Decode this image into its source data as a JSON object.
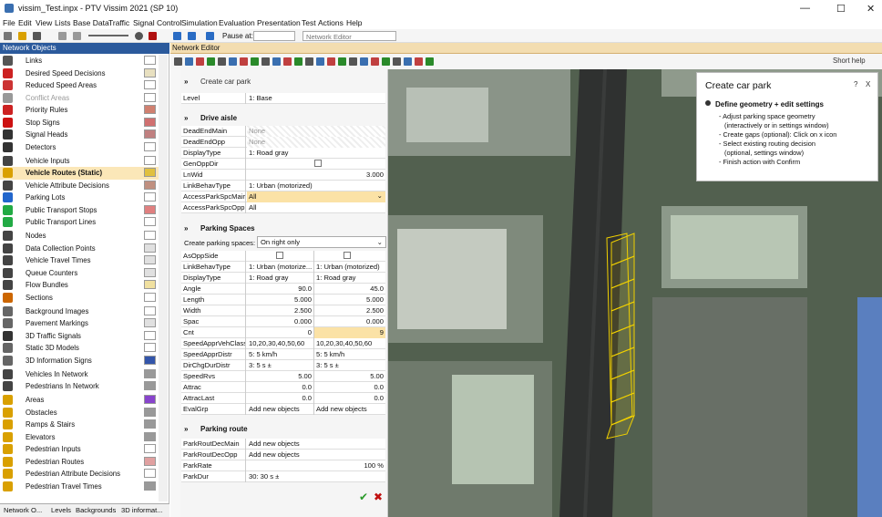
{
  "window": {
    "title": "vissim_Test.inpx - PTV Vissim 2021 (SP 10)",
    "controls": [
      "—",
      "☐",
      "✕"
    ]
  },
  "menu": [
    "File",
    "Edit",
    "View",
    "Lists",
    "Base Data",
    "Traffic",
    "Signal Control",
    "Simulation",
    "Evaluation",
    "Presentation",
    "Test",
    "Actions",
    "Help"
  ],
  "toolbar": {
    "pause_label": "Pause at:",
    "editor_select": "Network Editor"
  },
  "network_objects": {
    "title": "Network Objects",
    "items": [
      {
        "label": "Links",
        "icon_color": "#555555",
        "swatch": "#ffffff"
      },
      {
        "label": "Desired Speed Decisions",
        "icon_color": "#cc2222",
        "swatch": "#e8e0c0"
      },
      {
        "label": "Reduced Speed Areas",
        "icon_color": "#cc3333",
        "swatch": "#ffffff"
      },
      {
        "label": "Conflict Areas",
        "icon_color": "#999999",
        "swatch": "#ffffff",
        "dim": true
      },
      {
        "label": "Priority Rules",
        "icon_color": "#cc2222",
        "swatch": "#d08070"
      },
      {
        "label": "Stop Signs",
        "icon_color": "#cc1111",
        "swatch": "#d07070"
      },
      {
        "label": "Signal Heads",
        "icon_color": "#333333",
        "swatch": "#c08080"
      },
      {
        "label": "Detectors",
        "icon_color": "#333333",
        "swatch": "#ffffff"
      },
      {
        "label": "Vehicle Inputs",
        "icon_color": "#444444",
        "swatch": "#ffffff"
      },
      {
        "label": "Vehicle Routes (Static)",
        "icon_color": "#d9a000",
        "swatch": "#e0c040",
        "selected": true
      },
      {
        "label": "Vehicle Attribute Decisions",
        "icon_color": "#444444",
        "swatch": "#c09080"
      },
      {
        "label": "Parking Lots",
        "icon_color": "#2266cc",
        "swatch": "#ffffff"
      },
      {
        "label": "Public Transport Stops",
        "icon_color": "#22aa44",
        "swatch": "#e08080"
      },
      {
        "label": "Public Transport Lines",
        "icon_color": "#22aa44",
        "swatch": "#ffffff"
      },
      {
        "label": "Nodes",
        "icon_color": "#444444",
        "swatch": "#ffffff"
      },
      {
        "label": "Data Collection Points",
        "icon_color": "#444444",
        "swatch": "#e0e0e0"
      },
      {
        "label": "Vehicle Travel Times",
        "icon_color": "#444444",
        "swatch": "#e0e0e0"
      },
      {
        "label": "Queue Counters",
        "icon_color": "#444444",
        "swatch": "#e0e0e0"
      },
      {
        "label": "Flow Bundles",
        "icon_color": "#444444",
        "swatch": "#f0e0a0"
      },
      {
        "label": "Sections",
        "icon_color": "#cc6600",
        "swatch": "#ffffff"
      },
      {
        "label": "Background Images",
        "icon_color": "#666666",
        "swatch": "#ffffff"
      },
      {
        "label": "Pavement Markings",
        "icon_color": "#666666",
        "swatch": "#e0e0e0"
      },
      {
        "label": "3D Traffic Signals",
        "icon_color": "#333333",
        "swatch": "#ffffff"
      },
      {
        "label": "Static 3D Models",
        "icon_color": "#666666",
        "swatch": "#ffffff"
      },
      {
        "label": "3D Information Signs",
        "icon_color": "#666666",
        "swatch": "#3355aa"
      },
      {
        "label": "Vehicles In Network",
        "icon_color": "#444444",
        "swatch": "#999999"
      },
      {
        "label": "Pedestrians In Network",
        "icon_color": "#444444",
        "swatch": "#999999"
      },
      {
        "label": "Areas",
        "icon_color": "#d9a000",
        "swatch": "#8844cc"
      },
      {
        "label": "Obstacles",
        "icon_color": "#d9a000",
        "swatch": "#999999"
      },
      {
        "label": "Ramps & Stairs",
        "icon_color": "#d9a000",
        "swatch": "#999999"
      },
      {
        "label": "Elevators",
        "icon_color": "#d9a000",
        "swatch": "#999999"
      },
      {
        "label": "Pedestrian Inputs",
        "icon_color": "#d9a000",
        "swatch": "#ffffff"
      },
      {
        "label": "Pedestrian Routes",
        "icon_color": "#d9a000",
        "swatch": "#e0a0a0"
      },
      {
        "label": "Pedestrian Attribute Decisions",
        "icon_color": "#d9a000",
        "swatch": "#ffffff"
      },
      {
        "label": "Pedestrian Travel Times",
        "icon_color": "#d9a000",
        "swatch": "#999999"
      }
    ],
    "tabs": [
      "Network O...",
      "Levels",
      "Backgrounds",
      "3D informat..."
    ]
  },
  "editor": {
    "title": "Network Editor",
    "short_help": "Short help",
    "header_label": "Create car park",
    "level": {
      "key": "Level",
      "value": "1: Base"
    },
    "drive_aisle": {
      "title": "Drive aisle",
      "rows": [
        {
          "key": "DeadEndMain",
          "value": "None",
          "hatched": true
        },
        {
          "key": "DeadEndOpp",
          "value": "None",
          "hatched": true
        },
        {
          "key": "DisplayType",
          "value": "1: Road gray"
        },
        {
          "key": "GenOppDir",
          "value": ""
        },
        {
          "key": "LnWid",
          "value": "3.000"
        },
        {
          "key": "LinkBehavType",
          "value": "1: Urban (motorized)"
        },
        {
          "key": "AccessParkSpcMain",
          "value": "All"
        },
        {
          "key": "AccessParkSpcOpp",
          "value": "All"
        }
      ]
    },
    "parking_spaces": {
      "title": "Parking Spaces",
      "create_label": "Create parking spaces:",
      "create_value": "On right only",
      "rows": [
        {
          "key": "AsOppSide",
          "a": "",
          "b": ""
        },
        {
          "key": "LinkBehavType",
          "a": "1: Urban (motorize...",
          "b": "1: Urban (motorized)"
        },
        {
          "key": "DisplayType",
          "a": "1: Road gray",
          "b": "1: Road gray"
        },
        {
          "key": "Angle",
          "a": "90.0",
          "b": "45.0"
        },
        {
          "key": "Length",
          "a": "5.000",
          "b": "5.000"
        },
        {
          "key": "Width",
          "a": "2.500",
          "b": "2.500"
        },
        {
          "key": "Spac",
          "a": "0.000",
          "b": "0.000"
        },
        {
          "key": "Cnt",
          "a": "0",
          "b": "9"
        },
        {
          "key": "SpeedApprVehClass",
          "a": "10,20,30,40,50,60",
          "b": "10,20,30,40,50,60"
        },
        {
          "key": "SpeedApprDistr",
          "a": "5: 5 km/h",
          "b": "5: 5 km/h"
        },
        {
          "key": "DirChgDurDistr",
          "a": "3: 5 s ±",
          "b": "3: 5 s ±"
        },
        {
          "key": "SpeedRvs",
          "a": "5.00",
          "b": "5.00"
        },
        {
          "key": "Attrac",
          "a": "0.0",
          "b": "0.0"
        },
        {
          "key": "AttracLast",
          "a": "0.0",
          "b": "0.0"
        },
        {
          "key": "EvalGrp",
          "a": "Add new objects",
          "b": "Add new objects"
        }
      ]
    },
    "parking_route": {
      "title": "Parking route",
      "rows": [
        {
          "key": "ParkRoutDecMain",
          "value": "Add new objects"
        },
        {
          "key": "ParkRoutDecOpp",
          "value": "Add new objects"
        },
        {
          "key": "ParkRate",
          "value": "100 %"
        },
        {
          "key": "ParkDur",
          "value": "30: 30 s ±"
        }
      ]
    },
    "ok": "✔",
    "cancel": "✖"
  },
  "help": {
    "title": "Create car park",
    "question": "?",
    "close": "X",
    "heading": "Define geometry + edit settings",
    "lines": [
      "- Adjust parking space geometry",
      "(interactively or in settings window)",
      "- Create gaps (optional): Click on x icon",
      "- Select existing routing decision",
      "(optional, settings window)",
      "- Finish action with Confirm"
    ]
  }
}
